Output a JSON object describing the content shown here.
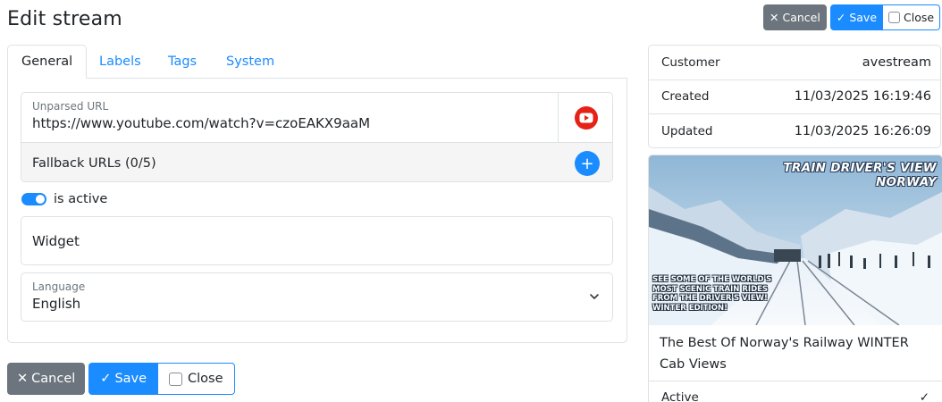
{
  "page": {
    "title": "Edit stream"
  },
  "actions": {
    "cancel_label": "Cancel",
    "save_label": "Save",
    "close_label": "Close",
    "close_checked": false
  },
  "tabs": [
    {
      "label": "General",
      "active": true
    },
    {
      "label": "Labels",
      "active": false
    },
    {
      "label": "Tags",
      "active": false
    },
    {
      "label": "System",
      "active": false
    }
  ],
  "form": {
    "unparsed_url": {
      "label": "Unparsed URL",
      "value": "https://www.youtube.com/watch?v=czoEAKX9aaM",
      "icon": "youtube-icon"
    },
    "fallback": {
      "label": "Fallback URLs (0/5)",
      "add_icon": "plus-icon"
    },
    "is_active": {
      "label": "is active",
      "checked": true
    },
    "widget": {
      "value": "Widget"
    },
    "language": {
      "label": "Language",
      "value": "English"
    }
  },
  "info": {
    "rows": [
      {
        "key": "Customer",
        "value": "avestream"
      },
      {
        "key": "Created",
        "value": "11/03/2025 16:19:46"
      },
      {
        "key": "Updated",
        "value": "11/03/2025 16:26:09"
      }
    ]
  },
  "media": {
    "thumbnail_title": "TRAIN DRIVER'S VIEW NORWAY",
    "thumbnail_caption": "SEE SOME OF THE WORLD'S MOST SCENIC TRAIN RIDES FROM THE DRIVER'S VIEW! WINTER EDITION!",
    "title": "The Best Of Norway's Railway WINTER Cab Views",
    "active_label": "Active",
    "active_icon": "checkmark-icon"
  },
  "colors": {
    "primary": "#1a8cff",
    "secondary": "#6c757d",
    "youtube_red": "#e62117",
    "border": "#dee2e6"
  }
}
